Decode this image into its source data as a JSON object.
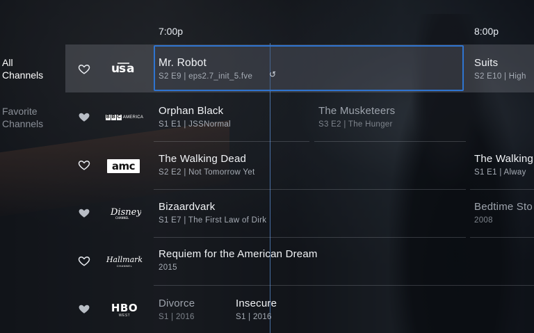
{
  "timeline": {
    "slot1": "7:00p",
    "slot2": "8:00p"
  },
  "sidebar": {
    "items": [
      {
        "label": "All Channels",
        "line1": "All",
        "line2": "Channels",
        "active": true
      },
      {
        "label": "Favorite Channels",
        "line1": "Favorite",
        "line2": "Channels",
        "active": false
      }
    ]
  },
  "channels": [
    {
      "logo": "usa",
      "favorite": false,
      "programs": [
        {
          "title": "Mr. Robot",
          "subtitle": "S2 E9  |  eps2.7_init_5.fve"
        },
        {
          "title": "Suits",
          "subtitle": "S2 E10  |  High"
        }
      ]
    },
    {
      "logo": "BBC AMERICA",
      "favorite": true,
      "programs": [
        {
          "title": "Orphan Black",
          "subtitle": "S1 E1  |  JSSNormal"
        },
        {
          "title": "The Musketeers",
          "subtitle": "S3 E2  |  The Hunger"
        }
      ]
    },
    {
      "logo": "amc",
      "favorite": false,
      "programs": [
        {
          "title": "The Walking Dead",
          "subtitle": "S2 E2  |  Not Tomorrow Yet"
        },
        {
          "title": "The Walking",
          "subtitle": "S1 E1  |  Alway"
        }
      ]
    },
    {
      "logo": "Disney Channel",
      "favorite": true,
      "programs": [
        {
          "title": "Bizaardvark",
          "subtitle": "S1 E7  |  The First Law of Dirk"
        },
        {
          "title": "Bedtime Sto",
          "subtitle": "2008"
        }
      ]
    },
    {
      "logo": "Hallmark Channel",
      "logo_line1": "Hallmark",
      "logo_line2": "CHANNEL",
      "favorite": false,
      "programs": [
        {
          "title": "Requiem for the American Dream",
          "subtitle": "2015"
        }
      ]
    },
    {
      "logo": "HBO West",
      "logo_line1": "HBO",
      "logo_line2": "WEST",
      "favorite": true,
      "programs": [
        {
          "title": "Divorce",
          "subtitle": "S1  |  2016"
        },
        {
          "title": "Insecure",
          "subtitle": "S1  |  2016"
        }
      ]
    }
  ],
  "colors": {
    "focus": "#2f74d0",
    "now_line": "#5a8cd2"
  },
  "icons": {
    "heart": "heart-icon",
    "loading": "loading-icon"
  }
}
